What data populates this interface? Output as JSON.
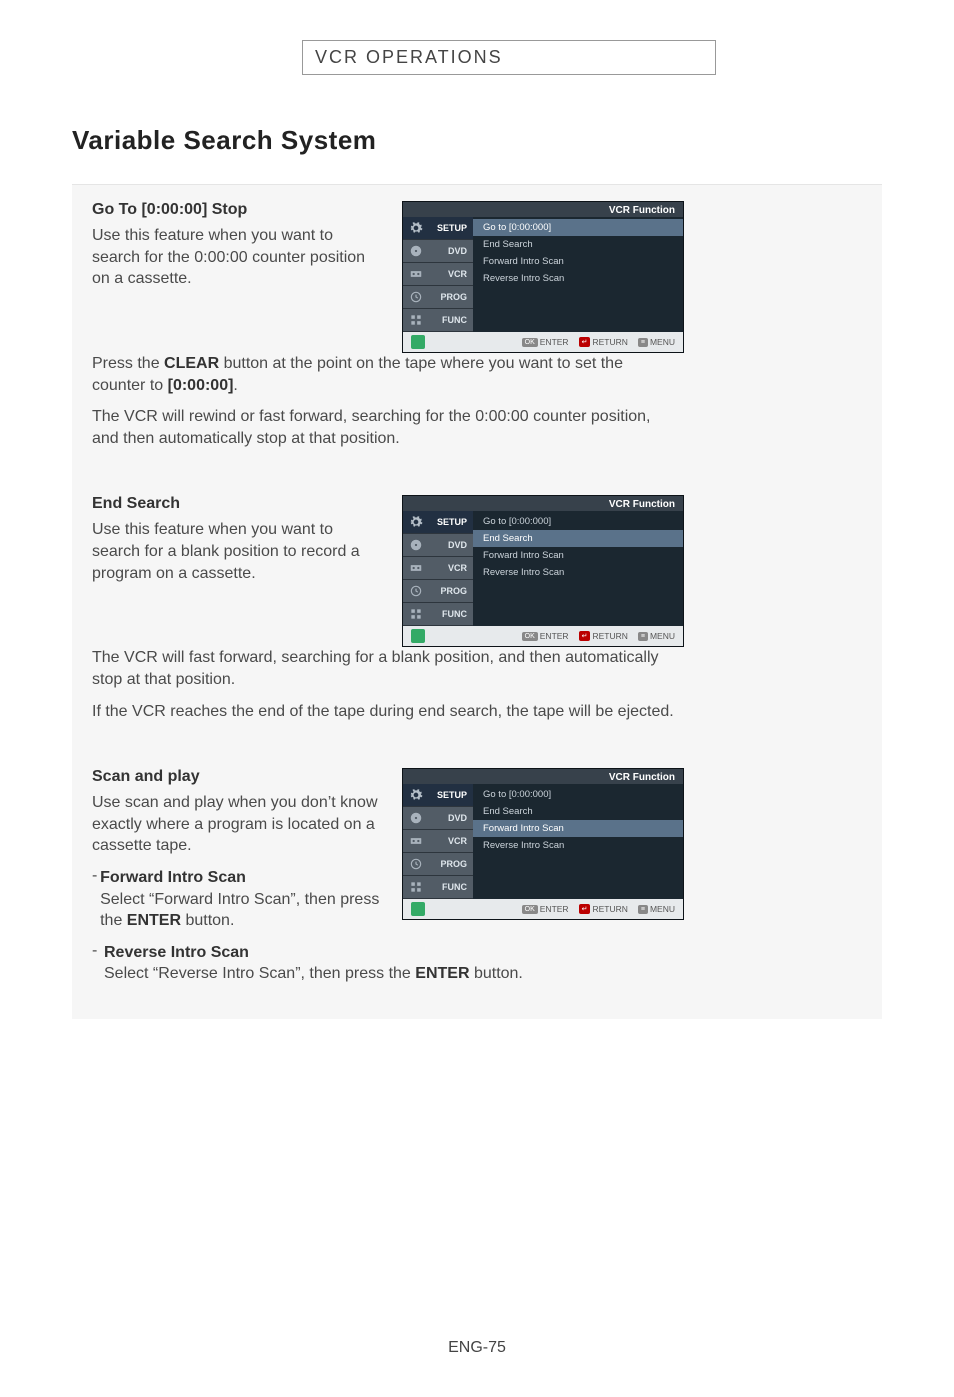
{
  "header": {
    "band": "VCR OPERATIONS"
  },
  "title": "Variable Search System",
  "osd_common": {
    "head": "VCR Function",
    "tabs": [
      {
        "label": "SETUP"
      },
      {
        "label": "DVD"
      },
      {
        "label": "VCR"
      },
      {
        "label": "PROG"
      },
      {
        "label": "FUNC"
      }
    ],
    "opts": [
      "Go to [0:00:000]",
      "End Search",
      "Forward Intro Scan",
      "Reverse Intro Scan"
    ],
    "foot": {
      "enter_pill": "OK",
      "enter": "ENTER",
      "return_pill": "↵",
      "return": "RETURN",
      "menu_pill": "≡",
      "menu": "MENU"
    }
  },
  "s1": {
    "head": "Go To [0:00:00] Stop",
    "p1": "Use this feature when you want to search for the 0:00:00 counter position on a cassette.",
    "p2a": "Press the ",
    "p2_btn": "CLEAR",
    "p2b": " button at the point on the tape where you want to set the counter to ",
    "p2_val": "[0:00:00]",
    "p2c": ".",
    "p3": "The VCR will rewind or fast forward, searching for the 0:00:00 counter position, and then automatically stop at that position.",
    "sel_index": 0
  },
  "s2": {
    "head": "End Search",
    "p1": "Use this feature when you want to search for a blank position to record a program on a cassette.",
    "p2": "The VCR will fast forward, searching for a blank position, and then automatically stop at that position.",
    "p3": "If the VCR reaches the end of the tape during end search, the tape will be ejected.",
    "sel_index": 1
  },
  "s3": {
    "head": "Scan and play",
    "p1": "Use scan and play when you don’t know exactly where a program is located on a cassette tape.",
    "fwd_head": "Forward Intro Scan",
    "fwd_body_a": "Select “Forward Intro Scan”, then press the ",
    "fwd_body_btn": "ENTER",
    "fwd_body_b": " button.",
    "rev_head": "Reverse Intro Scan",
    "rev_body_a": "Select “Reverse Intro Scan”, then press the ",
    "rev_body_btn": "ENTER",
    "rev_body_b": " button.",
    "sel_index": 2
  },
  "footer": "ENG-75"
}
